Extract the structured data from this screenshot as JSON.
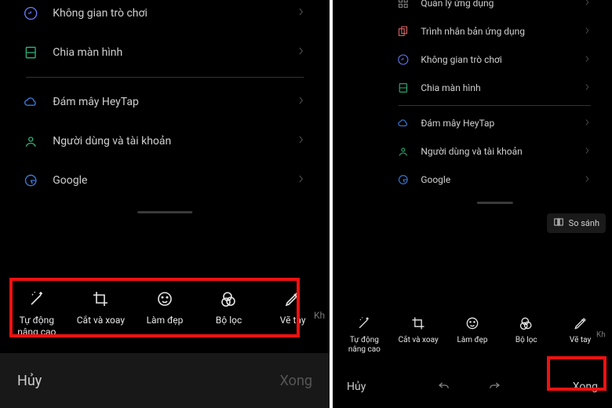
{
  "left": {
    "items": [
      {
        "label": "Không gian trò chơi",
        "icon": "gamepad"
      },
      {
        "label": "Chia màn hình",
        "icon": "split"
      },
      {
        "label": "Đám mây HeyTap",
        "icon": "cloud"
      },
      {
        "label": "Người dùng và tài khoản",
        "icon": "user"
      },
      {
        "label": "Google",
        "icon": "google"
      }
    ],
    "tools": [
      {
        "label": "Tự động nâng cao",
        "icon": "wand"
      },
      {
        "label": "Cắt và xoay",
        "icon": "crop"
      },
      {
        "label": "Làm đẹp",
        "icon": "face"
      },
      {
        "label": "Bộ lọc",
        "icon": "filter"
      },
      {
        "label": "Vẽ tay",
        "icon": "pencil"
      }
    ],
    "overflow_hint": "Kh",
    "cancel": "Hủy",
    "done": "Xong"
  },
  "right": {
    "items": [
      {
        "label": "Quản lý ứng dụng",
        "icon": "apps"
      },
      {
        "label": "Trình nhân bản ứng dụng",
        "icon": "clone"
      },
      {
        "label": "Không gian trò chơi",
        "icon": "gamepad"
      },
      {
        "label": "Chia màn hình",
        "icon": "split"
      },
      {
        "label": "Đám mây HeyTap",
        "icon": "cloud"
      },
      {
        "label": "Người dùng và tài khoản",
        "icon": "user"
      },
      {
        "label": "Google",
        "icon": "google"
      }
    ],
    "compare": "So sánh",
    "tools": [
      {
        "label": "Tự động nâng cao",
        "icon": "wand"
      },
      {
        "label": "Cắt và xoay",
        "icon": "crop"
      },
      {
        "label": "Làm đẹp",
        "icon": "face"
      },
      {
        "label": "Bộ lọc",
        "icon": "filter"
      },
      {
        "label": "Vẽ tay",
        "icon": "pencil"
      }
    ],
    "overflow_hint": "Kh",
    "cancel": "Hủy",
    "done": "Xong"
  },
  "highlights": {
    "toolbar": true,
    "done": true
  }
}
